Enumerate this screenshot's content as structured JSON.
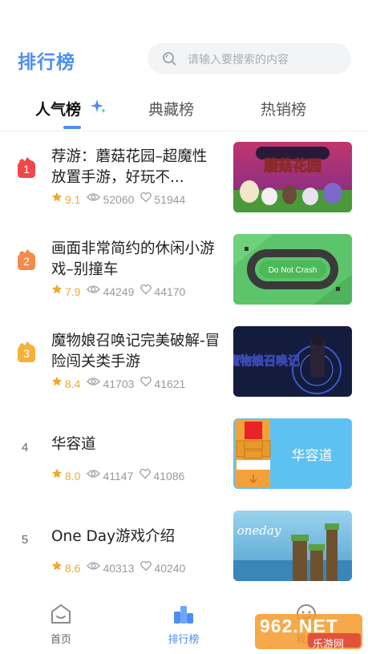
{
  "header": {
    "title": "排行榜",
    "search_placeholder": "请输入要搜索的内容"
  },
  "tabs": [
    {
      "label": "人气榜",
      "active": true
    },
    {
      "label": "典藏榜",
      "active": false
    },
    {
      "label": "热销榜",
      "active": false
    }
  ],
  "colors": {
    "accent": "#4f8ef0",
    "score": "#f0a830",
    "rank1": "#f04848",
    "rank2": "#f58a4a",
    "rank3": "#f5b23a"
  },
  "games": [
    {
      "rank": "1",
      "title": "荐游：蘑菇花园–超魔性放置手游，好玩不...",
      "score": "9.1",
      "views": "52060",
      "likes": "51944",
      "thumb_text": "蘑菇花园"
    },
    {
      "rank": "2",
      "title": "画面非常简约的休闲小游戏–别撞车",
      "score": "7.9",
      "views": "44249",
      "likes": "44170",
      "thumb_text": "Do Not Crash"
    },
    {
      "rank": "3",
      "title": "魔物娘召唤记完美破解-冒险闯关类手游",
      "score": "8.4",
      "views": "41703",
      "likes": "41621",
      "thumb_text": "魔物娘召唤记"
    },
    {
      "rank": "4",
      "title": "华容道",
      "score": "8.0",
      "views": "41147",
      "likes": "41086",
      "thumb_text": "华容道"
    },
    {
      "rank": "5",
      "title": "One Day游戏介绍",
      "score": "8.6",
      "views": "40313",
      "likes": "40240",
      "thumb_text": "oneday"
    }
  ],
  "bottom_nav": [
    {
      "label": "首页",
      "icon": "home-icon",
      "active": false
    },
    {
      "label": "排行榜",
      "icon": "rank-icon",
      "active": true
    },
    {
      "label": "我的",
      "icon": "smile-icon",
      "active": false
    }
  ],
  "watermark": {
    "main": "962.NET",
    "sub": "乐游网"
  }
}
